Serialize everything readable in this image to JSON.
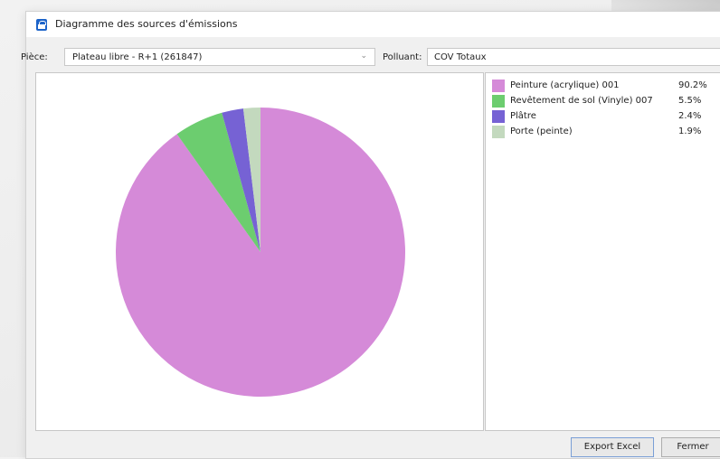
{
  "window": {
    "title": "Diagramme des sources d'émissions"
  },
  "toolbar": {
    "room_label": "Pièce:",
    "room_value": "Plateau libre - R+1 (261847)",
    "pollutant_label": "Polluant:",
    "pollutant_value": "COV Totaux"
  },
  "legend": {
    "items": [
      {
        "label": "Peinture (acrylique) 001",
        "value": "90.2%",
        "color": "#d58ad8"
      },
      {
        "label": "Revêtement de sol (Vinyle) 007",
        "value": "5.5%",
        "color": "#6ccd6f"
      },
      {
        "label": "Plâtre",
        "value": "2.4%",
        "color": "#7662d4"
      },
      {
        "label": "Porte (peinte)",
        "value": "1.9%",
        "color": "#c3d9be"
      }
    ]
  },
  "chart_data": {
    "type": "pie",
    "categories": [
      "Peinture (acrylique) 001",
      "Revêtement de sol (Vinyle) 007",
      "Plâtre",
      "Porte (peinte)"
    ],
    "values": [
      90.2,
      5.5,
      2.4,
      1.9
    ],
    "colors": [
      "#d58ad8",
      "#6ccd6f",
      "#7662d4",
      "#c3d9be"
    ],
    "direction": "clockwise",
    "start": "12 o'clock"
  },
  "footer": {
    "export_label": "Export Excel",
    "close_label": "Fermer"
  }
}
